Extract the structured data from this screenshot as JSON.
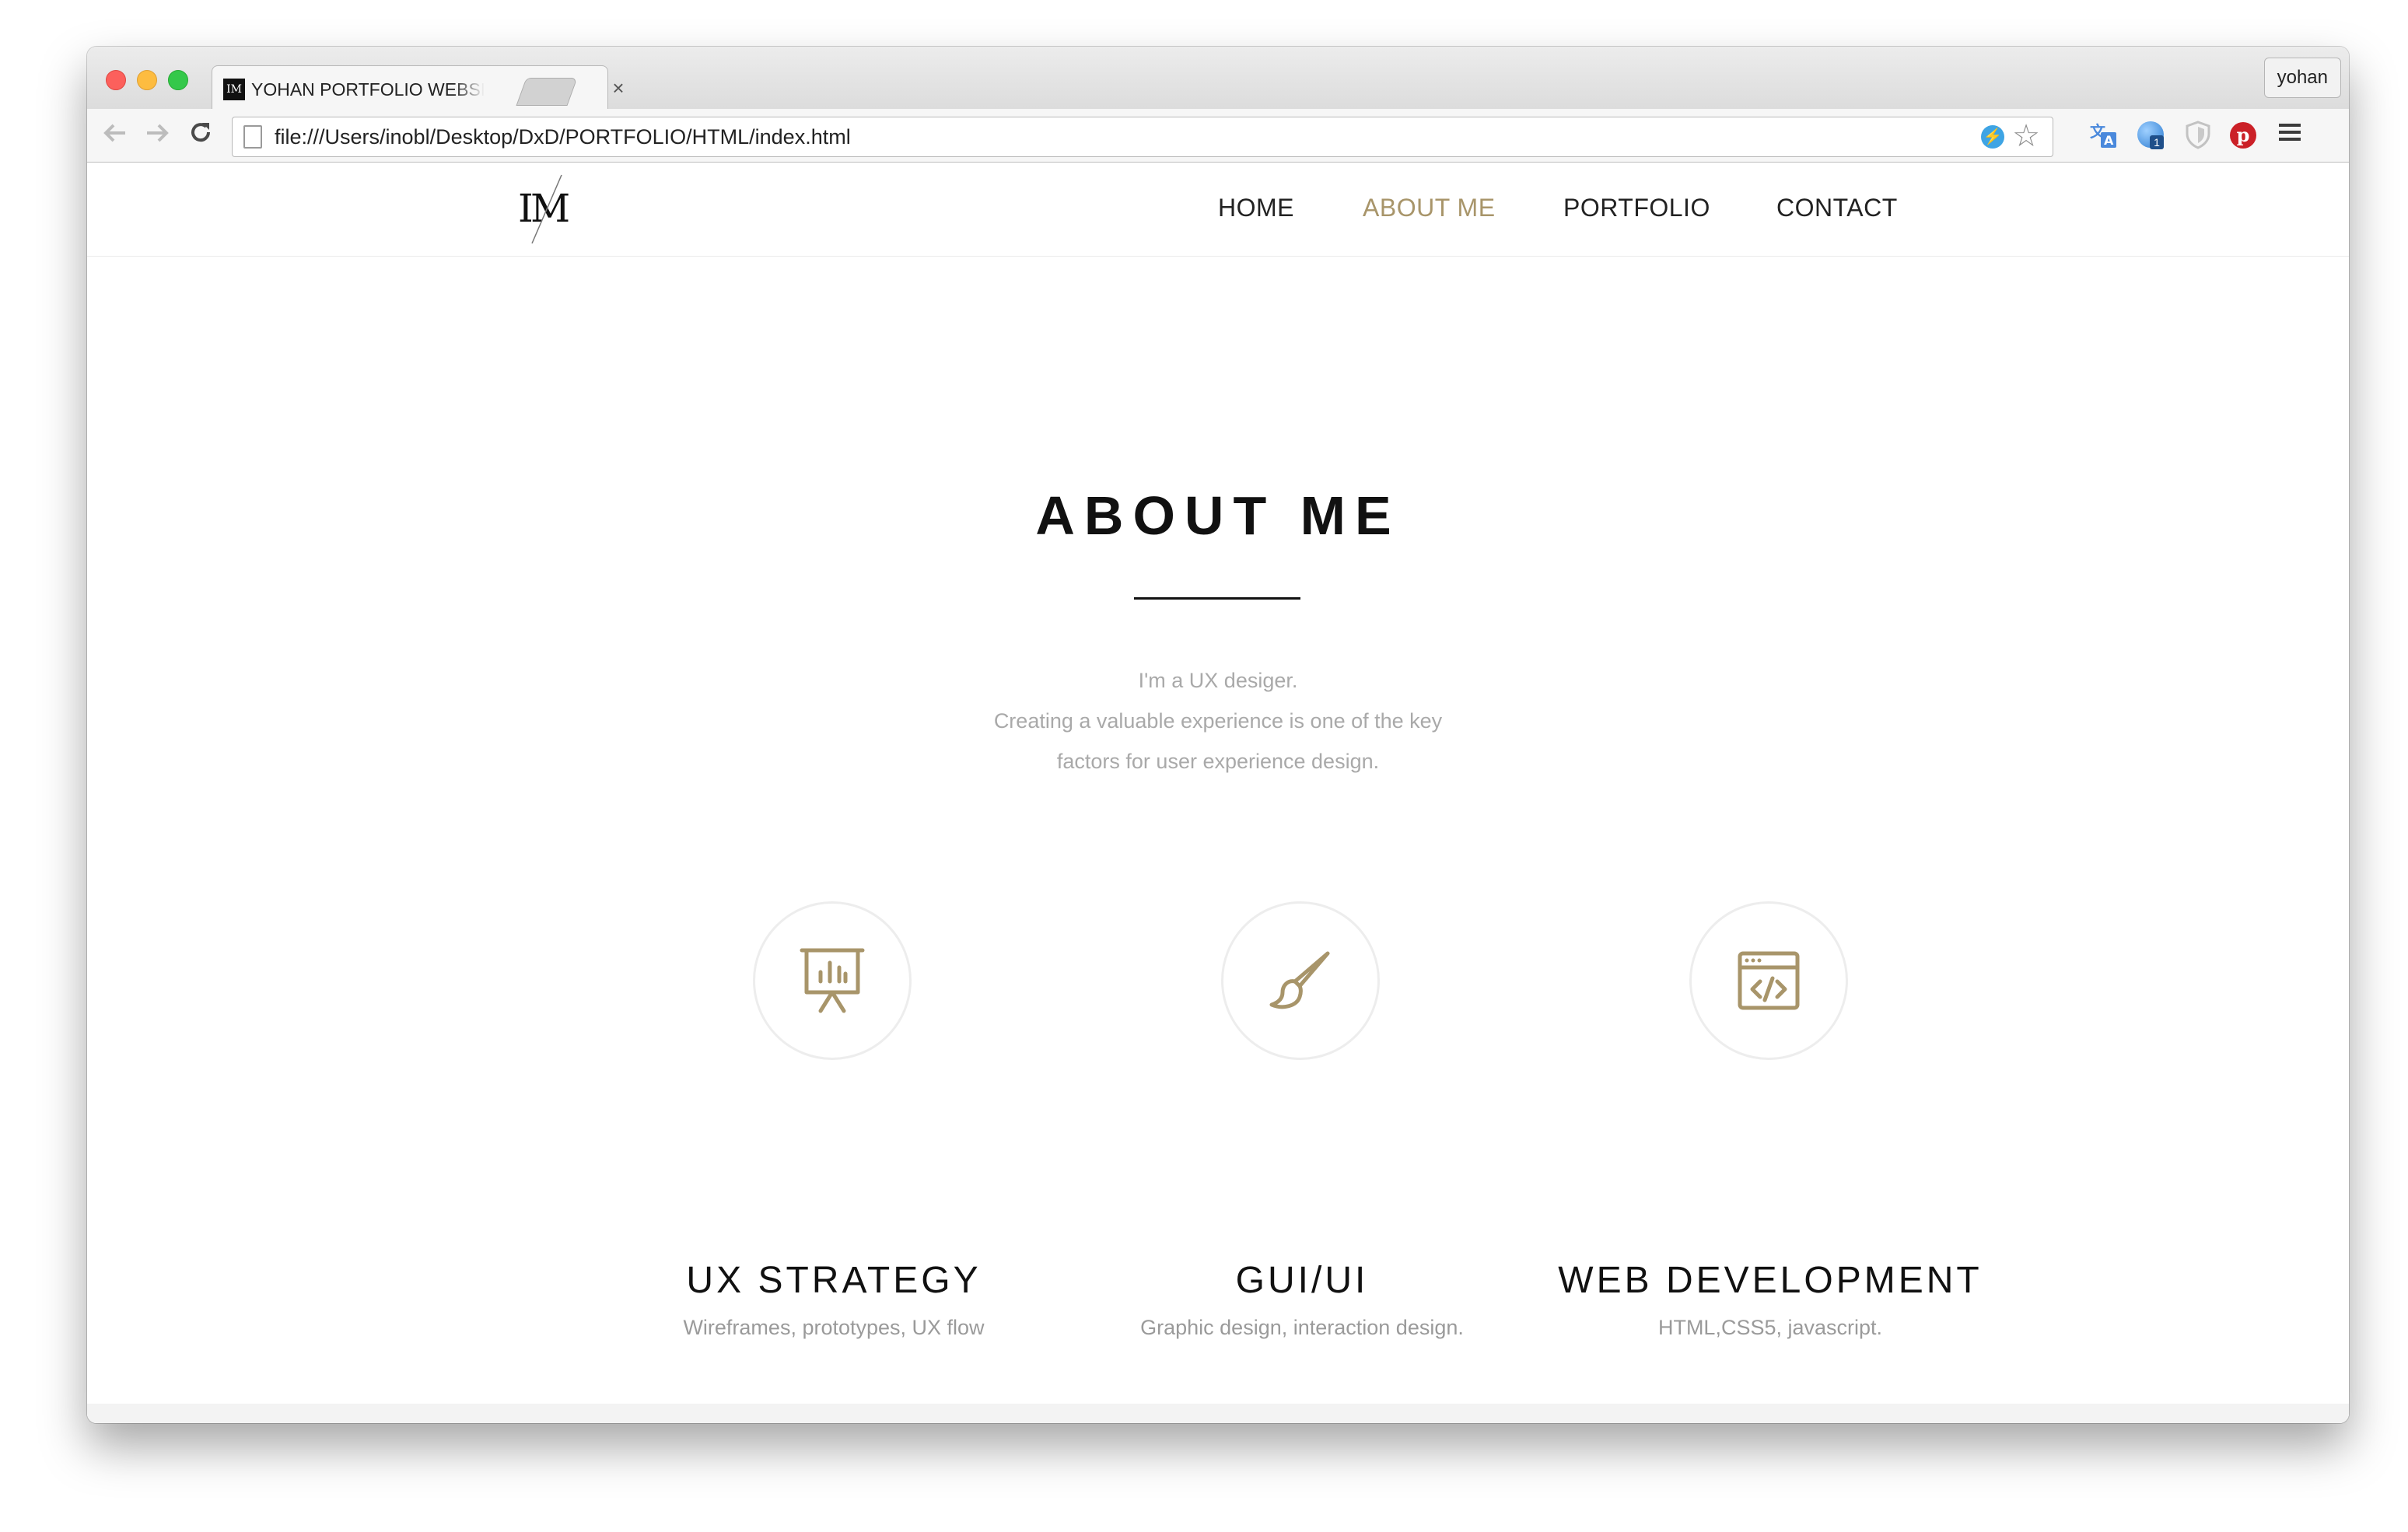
{
  "browser": {
    "tab_title": "YOHAN PORTFOLIO WEBSITE",
    "tab_close": "×",
    "profile_name": "yohan",
    "url": "file:///Users/inobl/Desktop/DxD/PORTFOLIO/HTML/index.html",
    "extension_badge": "1",
    "icons": [
      "back-icon",
      "forward-icon",
      "reload-icon",
      "page-icon",
      "bolt-icon",
      "star-icon",
      "translate-icon",
      "extension-ball-icon",
      "shield-icon",
      "pinterest-icon",
      "menu-icon"
    ]
  },
  "site": {
    "logo_text": "IM",
    "nav": [
      {
        "label": "HOME"
      },
      {
        "label": "ABOUT ME",
        "active": true
      },
      {
        "label": "PORTFOLIO"
      },
      {
        "label": "CONTACT"
      }
    ],
    "section_title": "ABOUT ME",
    "intro_lines": [
      "I'm a UX desiger.",
      "Creating a valuable experience is one of the key",
      "factors for user experience design."
    ],
    "services": [
      {
        "icon": "presentation-chart-icon",
        "title": "UX STRATEGY",
        "desc": "Wireframes, prototypes, UX flow"
      },
      {
        "icon": "paintbrush-icon",
        "title": "GUI/UI",
        "desc": "Graphic design, interaction design."
      },
      {
        "icon": "code-window-icon",
        "title": "WEB DEVELOPMENT",
        "desc": "HTML,CSS5, javascript."
      }
    ]
  },
  "colors": {
    "accent": "#a8956a",
    "text": "#111111",
    "muted": "#a9a9a9"
  }
}
